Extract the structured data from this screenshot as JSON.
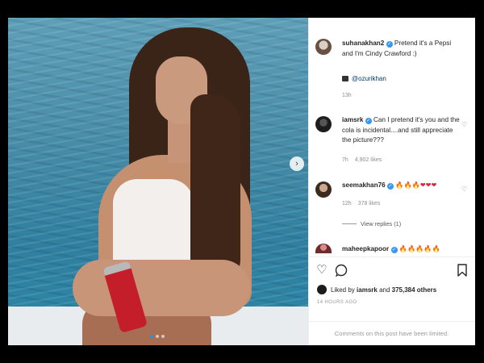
{
  "photo": {
    "alt_subject": "Instagram post photo",
    "carousel": {
      "next_icon": "chevron-right-icon",
      "dots": 3,
      "active_index": 0
    }
  },
  "caption": {
    "username": "suhanakhan2",
    "text": "Pretend it's a Pepsi and I'm Cindy Crawford :)",
    "mention": "@ozurikhan",
    "age": "13h"
  },
  "comments": [
    {
      "username": "iamsrk",
      "text": "Can I pretend it's you and the cola is incidental....and still appreciate the picture???",
      "age": "7h",
      "likes": "4,902 likes"
    },
    {
      "username": "seemakhan76",
      "emojis": [
        {
          "kind": "fire",
          "char": "🔥"
        },
        {
          "kind": "fire",
          "char": "🔥"
        },
        {
          "kind": "fire",
          "char": "🔥"
        },
        {
          "kind": "heart",
          "char": "❤"
        },
        {
          "kind": "heart",
          "char": "❤"
        },
        {
          "kind": "heart",
          "char": "❤"
        }
      ],
      "age": "12h",
      "likes": "378 likes",
      "view_replies": "View replies (1)"
    },
    {
      "username": "maheepkapoor",
      "emojis": [
        {
          "kind": "fire",
          "char": "🔥"
        },
        {
          "kind": "fire",
          "char": "🔥"
        },
        {
          "kind": "fire",
          "char": "🔥"
        },
        {
          "kind": "fire",
          "char": "🔥"
        },
        {
          "kind": "fire",
          "char": "🔥"
        }
      ]
    }
  ],
  "actions": {
    "like_icon": "heart-icon",
    "comment_icon": "comment-icon",
    "save_icon": "bookmark-icon"
  },
  "liked_by": {
    "prefix": "Liked by",
    "user": "iamsrk",
    "joiner": "and",
    "others": "375,384 others"
  },
  "timestamp": "14 HOURS AGO",
  "footer": "Comments on this post have been limited.",
  "colors": {
    "verified": "#3897f0",
    "muted": "#8e8e8e",
    "fire": "#e8600c",
    "heart": "#d7263d"
  }
}
